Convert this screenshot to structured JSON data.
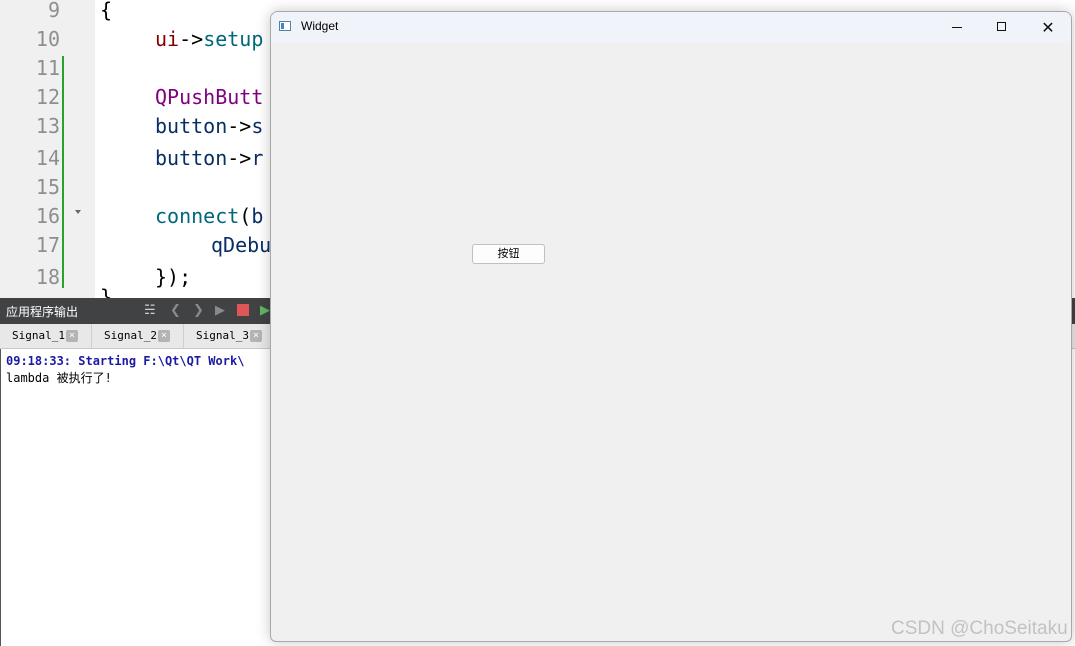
{
  "editor": {
    "line_numbers": [
      "9",
      "10",
      "11",
      "12",
      "13",
      "14",
      "15",
      "16",
      "17",
      "18"
    ],
    "lines": {
      "l9": "{",
      "l10_a": "ui",
      "l10_b": "->",
      "l10_c": "setup",
      "l12": "QPushButt",
      "l13_a": "button",
      "l13_b": "->",
      "l13_c": "s",
      "l14_a": "button",
      "l14_b": "->",
      "l14_c": "r",
      "l16_a": "connect",
      "l16_b": "(",
      "l16_c": "b",
      "l17": "qDebu",
      "l18": "});",
      "l19": "}"
    }
  },
  "output_pane": {
    "title": "应用程序输出",
    "tabs": [
      {
        "label": "Signal_1"
      },
      {
        "label": "Signal_2"
      },
      {
        "label": "Signal_3"
      }
    ],
    "lines": [
      "09:18:33: Starting F:\\Qt\\QT Work\\",
      "lambda 被执行了!"
    ]
  },
  "widget_window": {
    "title": "Widget",
    "button_label": "按钮"
  },
  "watermark": "CSDN @ChoSeitaku"
}
